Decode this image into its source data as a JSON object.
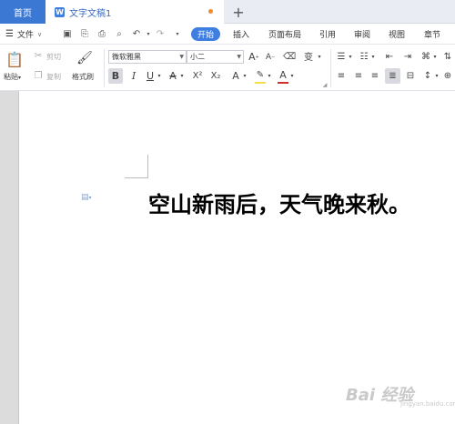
{
  "tabs": {
    "home_label": "首页",
    "doc_icon": "W",
    "doc_title": "文字文稿1",
    "add_label": "+"
  },
  "menubar": {
    "file_label": "文件",
    "menu_icon": "☰",
    "items": [
      "开始",
      "插入",
      "页面布局",
      "引用",
      "审阅",
      "视图",
      "章节"
    ]
  },
  "ribbon": {
    "paste_label": "粘贴",
    "cut_label": "剪切",
    "copy_label": "复制",
    "format_painter_label": "格式刷",
    "font_name": "微软雅黑",
    "font_size": "小二",
    "bold": "B",
    "italic": "I",
    "underline": "U",
    "strikethrough": "A",
    "superscript": "X²",
    "subscript": "X₂",
    "font_effect": "A",
    "font_color": "A",
    "phonetic": "变",
    "grow_font": "A",
    "shrink_font": "A"
  },
  "document": {
    "text": "空山新雨后，天气晚来秋。"
  },
  "watermark": {
    "brand": "Bai 经验",
    "url": "jingyan.baidu.com"
  },
  "colors": {
    "accent": "#3d7ee0",
    "home_tab": "#3a78d4",
    "unsaved_dot": "#f28a2e",
    "highlight": "#f5e04a",
    "font_color_bar": "#d0312d"
  }
}
